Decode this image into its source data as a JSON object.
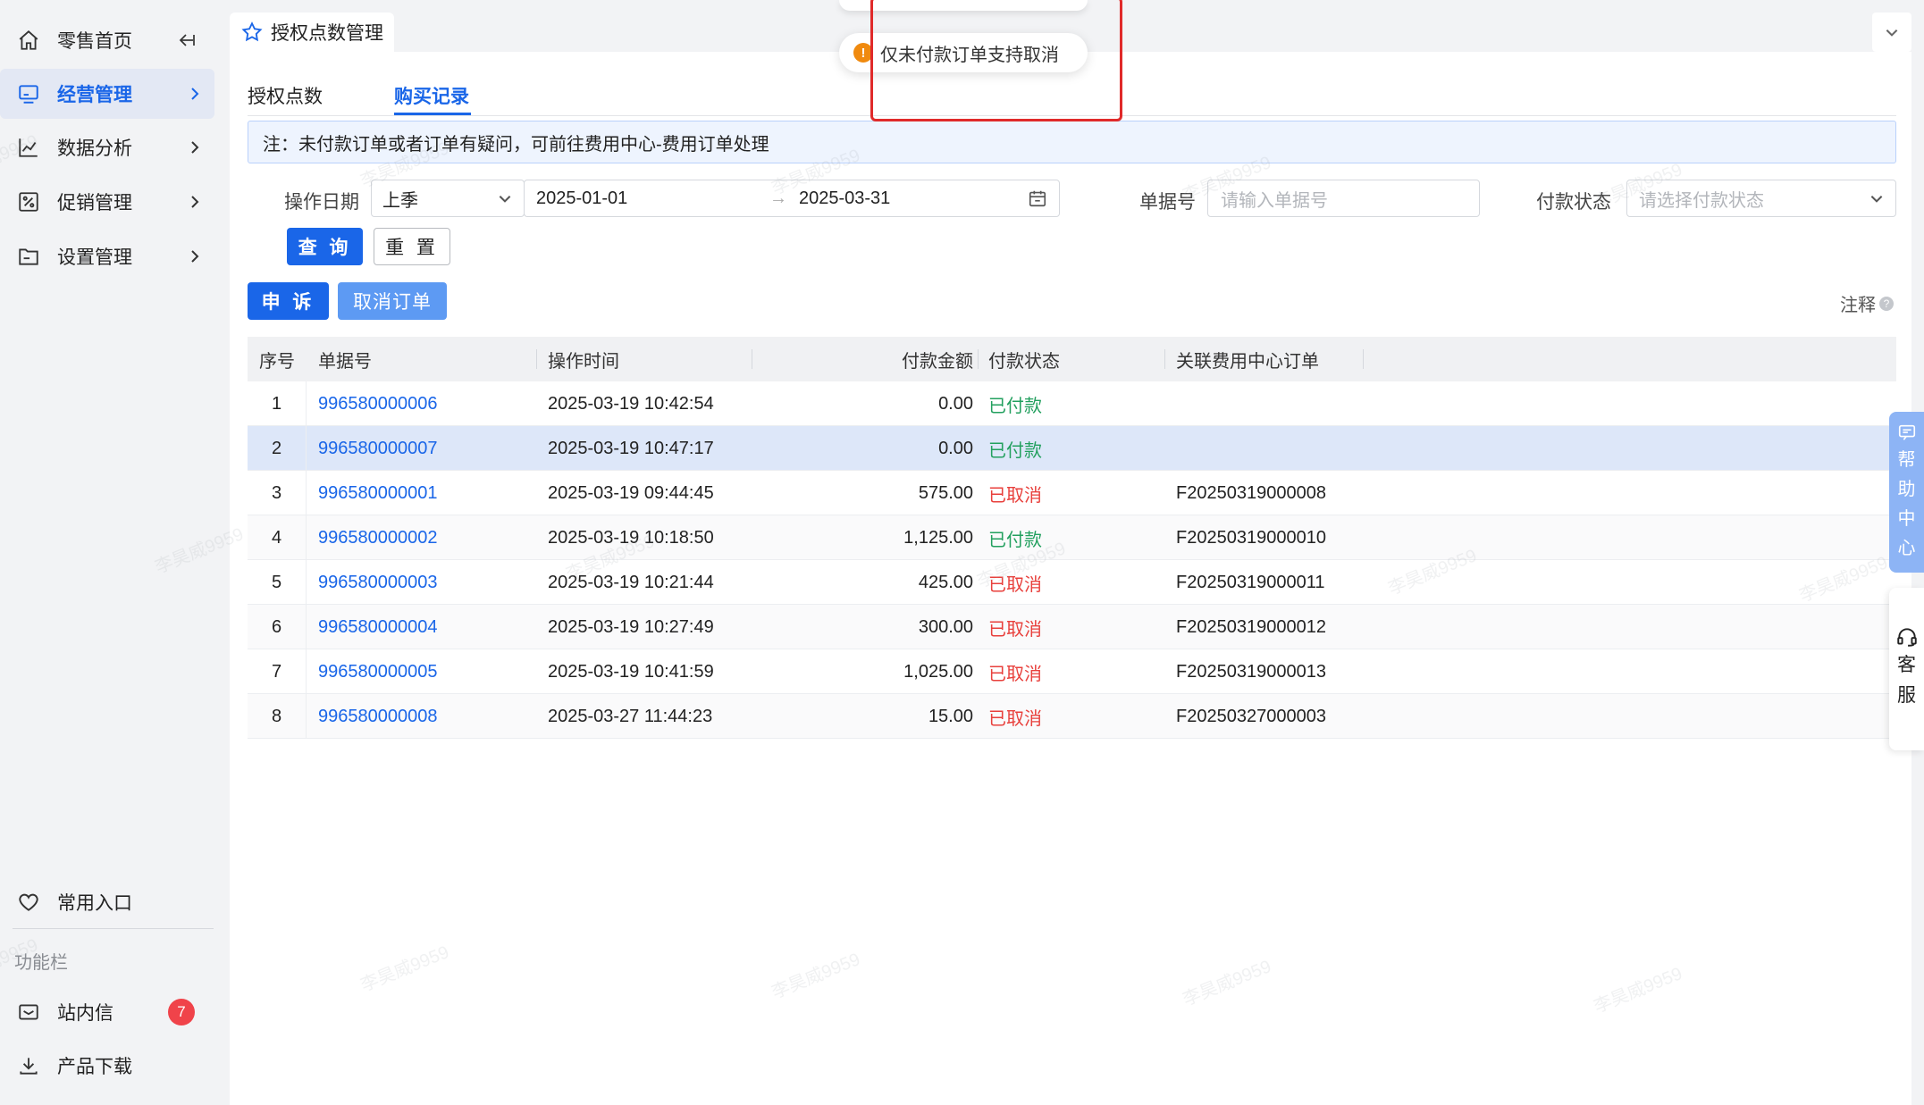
{
  "sidebar": {
    "collapse_icon": "collapse-left-icon",
    "items": [
      {
        "label": "零售首页",
        "icon": "home-icon"
      },
      {
        "label": "经营管理",
        "icon": "monitor-icon"
      },
      {
        "label": "数据分析",
        "icon": "chart-icon"
      },
      {
        "label": "促销管理",
        "icon": "promo-icon"
      },
      {
        "label": "设置管理",
        "icon": "folder-icon"
      }
    ],
    "favorites_label": "常用入口",
    "section_caption": "功能栏",
    "messages_label": "站内信",
    "messages_badge": "7",
    "download_label": "产品下载"
  },
  "page_tab": {
    "title": "授权点数管理",
    "icon": "star-icon"
  },
  "subtabs": [
    {
      "label": "授权点数",
      "active": false
    },
    {
      "label": "购买记录",
      "active": true
    }
  ],
  "notice": "注：未付款订单或者订单有疑问，可前往费用中心-费用订单处理",
  "filters": {
    "date_label": "操作日期",
    "period_value": "上季",
    "date_start": "2025-01-01",
    "date_end": "2025-03-31",
    "doc_label": "单据号",
    "doc_placeholder": "请输入单据号",
    "status_label": "付款状态",
    "status_placeholder": "请选择付款状态"
  },
  "buttons": {
    "query": "查 询",
    "reset": "重 置",
    "appeal": "申 诉",
    "cancel_order": "取消订单",
    "annotation": "注释"
  },
  "tooltip": "仅未付款订单支持取消",
  "table": {
    "headers": [
      "序号",
      "单据号",
      "操作时间",
      "付款金额",
      "付款状态",
      "关联费用中心订单"
    ],
    "rows": [
      {
        "idx": "1",
        "doc": "996580000006",
        "time": "2025-03-19 10:42:54",
        "amount": "0.00",
        "status": "已付款",
        "related": ""
      },
      {
        "idx": "2",
        "doc": "996580000007",
        "time": "2025-03-19 10:47:17",
        "amount": "0.00",
        "status": "已付款",
        "related": ""
      },
      {
        "idx": "3",
        "doc": "996580000001",
        "time": "2025-03-19 09:44:45",
        "amount": "575.00",
        "status": "已取消",
        "related": "F20250319000008"
      },
      {
        "idx": "4",
        "doc": "996580000002",
        "time": "2025-03-19 10:18:50",
        "amount": "1,125.00",
        "status": "已付款",
        "related": "F20250319000010"
      },
      {
        "idx": "5",
        "doc": "996580000003",
        "time": "2025-03-19 10:21:44",
        "amount": "425.00",
        "status": "已取消",
        "related": "F20250319000011"
      },
      {
        "idx": "6",
        "doc": "996580000004",
        "time": "2025-03-19 10:27:49",
        "amount": "300.00",
        "status": "已取消",
        "related": "F20250319000012"
      },
      {
        "idx": "7",
        "doc": "996580000005",
        "time": "2025-03-19 10:41:59",
        "amount": "1,025.00",
        "status": "已取消",
        "related": "F20250319000013"
      },
      {
        "idx": "8",
        "doc": "996580000008",
        "time": "2025-03-27 11:44:23",
        "amount": "15.00",
        "status": "已取消",
        "related": "F20250327000003"
      }
    ]
  },
  "floating": {
    "help": [
      "帮",
      "助",
      "中",
      "心"
    ],
    "service": [
      "客",
      "服"
    ]
  },
  "watermark": "李昊威9959",
  "colors": {
    "accent": "#1a66e8",
    "paid": "#23a05f",
    "cancelled": "#e8403c",
    "highlight_box": "#e02a2a"
  }
}
